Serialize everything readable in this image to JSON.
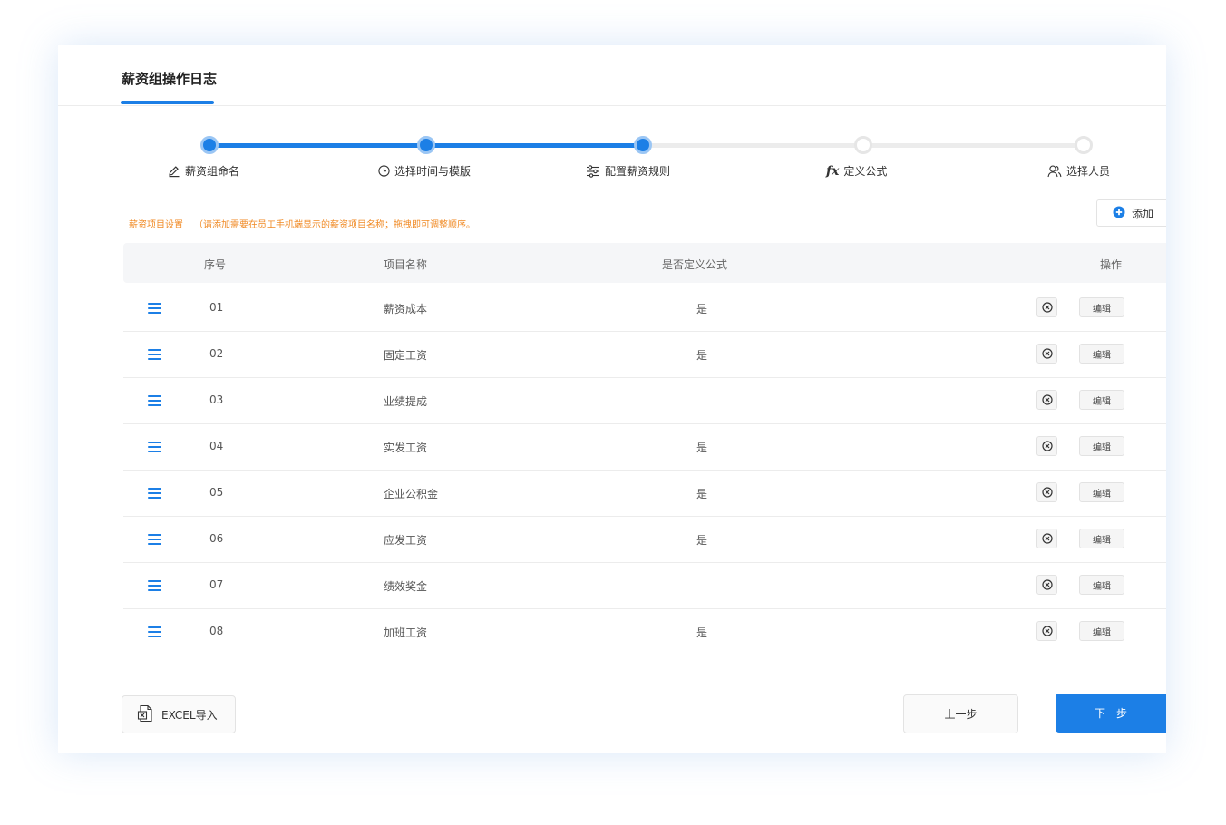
{
  "tab": {
    "title": "薪资组操作日志"
  },
  "steps": [
    {
      "label": "薪资组命名",
      "icon": "edit-icon",
      "state": "done"
    },
    {
      "label": "选择时间与模版",
      "icon": "clock-icon",
      "state": "done"
    },
    {
      "label": "配置薪资规则",
      "icon": "sliders-icon",
      "state": "done"
    },
    {
      "label": "定义公式",
      "icon": "fx-icon",
      "state": "todo"
    },
    {
      "label": "选择人员",
      "icon": "user-icon",
      "state": "todo"
    }
  ],
  "fx_glyph": "fx",
  "hint": {
    "title": "薪资项目设置",
    "note": "（请添加需要在员工手机端显示的薪资项目名称；拖拽即可调整顺序。"
  },
  "add_button": {
    "label": "添加",
    "icon": "plus-circle-icon"
  },
  "table": {
    "headers": {
      "no": "序号",
      "name": "项目名称",
      "formula": "是否定义公式",
      "action": "操作"
    },
    "rows": [
      {
        "no": "01",
        "name": "薪资成本",
        "formula": "是"
      },
      {
        "no": "02",
        "name": "固定工资",
        "formula": "是"
      },
      {
        "no": "03",
        "name": "业绩提成",
        "formula": ""
      },
      {
        "no": "04",
        "name": "实发工资",
        "formula": "是"
      },
      {
        "no": "05",
        "name": "企业公积金",
        "formula": "是"
      },
      {
        "no": "06",
        "name": "应发工资",
        "formula": "是"
      },
      {
        "no": "07",
        "name": "绩效奖金",
        "formula": ""
      },
      {
        "no": "08",
        "name": "加班工资",
        "formula": "是"
      }
    ],
    "edit_label": "编辑",
    "delete_icon": "close-circle-icon",
    "drag_icon": "drag-handle-icon"
  },
  "footer": {
    "excel_label": "EXCEL导入",
    "excel_icon": "excel-file-icon",
    "prev_label": "上一步",
    "next_label": "下一步"
  },
  "colors": {
    "primary": "#1c7fe6",
    "hint": "#f08a24"
  }
}
